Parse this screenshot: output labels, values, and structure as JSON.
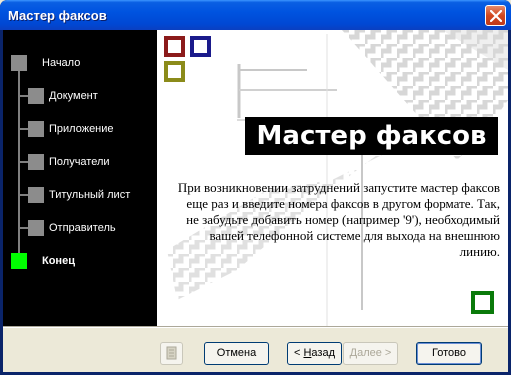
{
  "window": {
    "title": "Мастер факсов"
  },
  "steps": [
    {
      "label": "Начало",
      "current": false
    },
    {
      "label": "Документ",
      "current": false
    },
    {
      "label": "Приложение",
      "current": false
    },
    {
      "label": "Получатели",
      "current": false
    },
    {
      "label": "Титульный лист",
      "current": false
    },
    {
      "label": "Отправитель",
      "current": false
    },
    {
      "label": "Конец",
      "current": true
    }
  ],
  "content": {
    "heading": "Мастер факсов",
    "body": "При возникновении затруднений запустите мастер факсов еще раз и введите номера факсов в другом формате. Так, не забудьте добавить номер (например '9'), необходимый вашей телефонной системе для выхода на внешнюю линию."
  },
  "buttons": {
    "cancel": "Отмена",
    "back_prefix": "< ",
    "back_accel": "Н",
    "back_rest": "азад",
    "next": "Далее >",
    "finish": "Готово"
  },
  "colors": {
    "title_bar": "#0053e0",
    "side_panel": "#000000",
    "current_step": "#00ff00",
    "deco_red": "#8b1a1a",
    "deco_blue": "#1a1a8b",
    "deco_olive": "#8b8b1a",
    "deco_green": "#0a7a0a"
  }
}
